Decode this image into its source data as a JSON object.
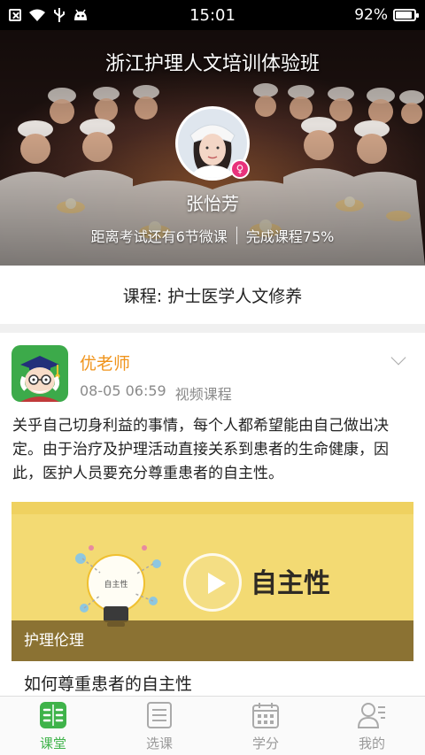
{
  "status_bar": {
    "time": "15:01",
    "battery": "92%",
    "battery_level": 0.92
  },
  "banner": {
    "title": "浙江护理人文培训体验班",
    "user_name": "张怡芳",
    "exam_text": "距离考试还有6节微课",
    "progress_text": "完成课程75%"
  },
  "course": {
    "label": "课程: 护士医学人文修养"
  },
  "post": {
    "author": "优老师",
    "date": "08-05 06:59",
    "type": "视频课程",
    "body": "关乎自己切身利益的事情，每个人都希望能由自己做出决定。由于治疗及护理活动直接关系到患者的生命健康，因此，医护人员要充分尊重患者的自主性。",
    "video": {
      "image_text": "自主性",
      "bulb_label": "自主性",
      "tag": "护理伦理",
      "title": "如何尊重患者的自主性"
    }
  },
  "nav": {
    "items": [
      {
        "label": "课堂",
        "icon": "classroom-icon",
        "active": true
      },
      {
        "label": "选课",
        "icon": "course-select-icon",
        "active": false
      },
      {
        "label": "学分",
        "icon": "credits-icon",
        "active": false
      },
      {
        "label": "我的",
        "icon": "profile-icon",
        "active": false
      }
    ]
  },
  "colors": {
    "accent": "#3fb34a",
    "author": "#f0941c",
    "badge": "#e8327c"
  }
}
